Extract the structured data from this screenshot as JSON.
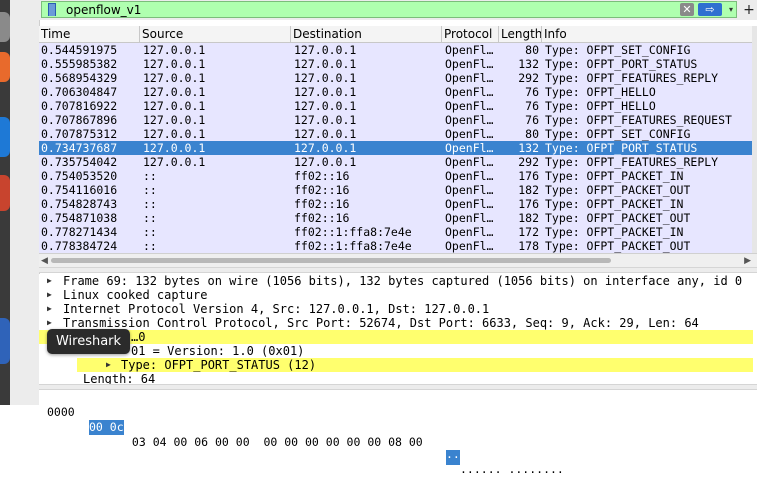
{
  "window": {
    "title": "Wireshark"
  },
  "colors": {
    "selected_row": "#3a83cf",
    "packet_row": "#e7e6ff",
    "filter_ok": "#afffaf",
    "highlight": "#ffff6e"
  },
  "filter": {
    "value": "openflow_v1",
    "bookmark_icon": "bookmark-icon",
    "clear_label": "✕",
    "apply_label": "⇨",
    "dropdown_label": "▾",
    "add_label": "+"
  },
  "packet_list": {
    "columns": [
      "Time",
      "Source",
      "Destination",
      "Protocol",
      "Length",
      "Info"
    ],
    "rows": [
      {
        "time": "0.544591975",
        "source": "127.0.0.1",
        "destination": "127.0.0.1",
        "protocol": "OpenFl…",
        "length": "80",
        "info": "Type: OFPT_SET_CONFIG"
      },
      {
        "time": "0.555985382",
        "source": "127.0.0.1",
        "destination": "127.0.0.1",
        "protocol": "OpenFl…",
        "length": "132",
        "info": "Type: OFPT_PORT_STATUS"
      },
      {
        "time": "0.568954329",
        "source": "127.0.0.1",
        "destination": "127.0.0.1",
        "protocol": "OpenFl…",
        "length": "292",
        "info": "Type: OFPT_FEATURES_REPLY"
      },
      {
        "time": "0.706304847",
        "source": "127.0.0.1",
        "destination": "127.0.0.1",
        "protocol": "OpenFl…",
        "length": "76",
        "info": "Type: OFPT_HELLO"
      },
      {
        "time": "0.707816922",
        "source": "127.0.0.1",
        "destination": "127.0.0.1",
        "protocol": "OpenFl…",
        "length": "76",
        "info": "Type: OFPT_HELLO"
      },
      {
        "time": "0.707867896",
        "source": "127.0.0.1",
        "destination": "127.0.0.1",
        "protocol": "OpenFl…",
        "length": "76",
        "info": "Type: OFPT_FEATURES_REQUEST"
      },
      {
        "time": "0.707875312",
        "source": "127.0.0.1",
        "destination": "127.0.0.1",
        "protocol": "OpenFl…",
        "length": "80",
        "info": "Type: OFPT_SET_CONFIG"
      },
      {
        "time": "0.734737687",
        "source": "127.0.0.1",
        "destination": "127.0.0.1",
        "protocol": "OpenFl…",
        "length": "132",
        "info": "Type: OFPT_PORT_STATUS"
      },
      {
        "time": "0.735754042",
        "source": "127.0.0.1",
        "destination": "127.0.0.1",
        "protocol": "OpenFl…",
        "length": "292",
        "info": "Type: OFPT_FEATURES_REPLY"
      },
      {
        "time": "0.754053520",
        "source": "::",
        "destination": "ff02::16",
        "protocol": "OpenFl…",
        "length": "176",
        "info": "Type: OFPT_PACKET_IN"
      },
      {
        "time": "0.754116016",
        "source": "::",
        "destination": "ff02::16",
        "protocol": "OpenFl…",
        "length": "182",
        "info": "Type: OFPT_PACKET_OUT"
      },
      {
        "time": "0.754828743",
        "source": "::",
        "destination": "ff02::16",
        "protocol": "OpenFl…",
        "length": "176",
        "info": "Type: OFPT_PACKET_IN"
      },
      {
        "time": "0.754871038",
        "source": "::",
        "destination": "ff02::16",
        "protocol": "OpenFl…",
        "length": "182",
        "info": "Type: OFPT_PACKET_OUT"
      },
      {
        "time": "0.778271434",
        "source": "::",
        "destination": "ff02::1:ffa8:7e4e",
        "protocol": "OpenFl…",
        "length": "172",
        "info": "Type: OFPT_PACKET_IN"
      },
      {
        "time": "0.778384724",
        "source": "::",
        "destination": "ff02::1:ffa8:7e4e",
        "protocol": "OpenFl…",
        "length": "178",
        "info": "Type: OFPT_PACKET_OUT"
      }
    ],
    "selected_index": 7
  },
  "details": {
    "lines": [
      "Frame 69: 132 bytes on wire (1056 bits), 132 bytes captured (1056 bits) on interface any, id 0",
      "Linux cooked capture",
      "Internet Protocol Version 4, Src: 127.0.0.1, Dst: 127.0.0.1",
      "Transmission Control Protocol, Src Port: 52674, Dst Port: 6633, Seq: 9, Ack: 29, Len: 64",
      "OpenFlow 1.0",
      ".000 0001 = Version: 1.0 (0x01)",
      "Type: OFPT_PORT_STATUS (12)",
      "Length: 64"
    ],
    "openflow_visible": "…0",
    "version_visible": "01 = Version: 1.0 (0x01)"
  },
  "tooltip": "Wireshark",
  "bytes": {
    "offset": "0000",
    "selected_hex": "00 0c",
    "rest_hex": " 03 04 00 06 00 00  00 00 00 00 00 00 08 00",
    "ascii_sel": "··",
    "ascii_rest": "······ ········"
  }
}
